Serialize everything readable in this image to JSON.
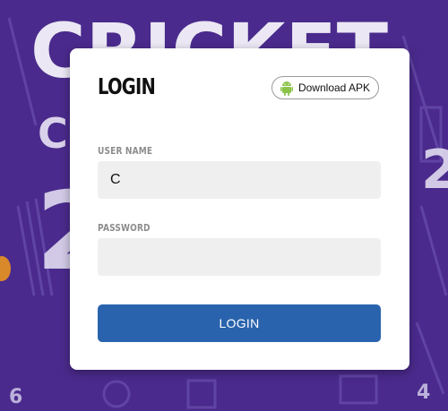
{
  "background": {
    "color": "#4a2a8c",
    "banner_text": "CRICKET"
  },
  "login": {
    "title": "LOGIN",
    "download_apk_label": "Download APK",
    "download_icon": "android-icon",
    "username_label": "USER NAME",
    "username_value": "C",
    "password_label": "PASSWORD",
    "password_value": "",
    "submit_label": "LOGIN",
    "accent_color": "#2a63ad"
  }
}
